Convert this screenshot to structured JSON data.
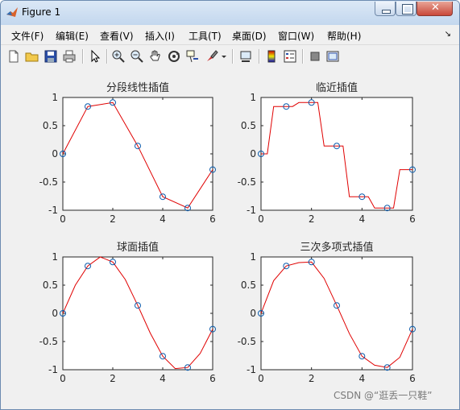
{
  "window": {
    "title": "Figure 1"
  },
  "menu": [
    "文件(F)",
    "编辑(E)",
    "查看(V)",
    "插入(I)",
    "工具(T)",
    "桌面(D)",
    "窗口(W)",
    "帮助(H)"
  ],
  "menu_overflow_icon": "chevron-icon",
  "toolbar_icons": [
    "new-figure-icon",
    "open-file-icon",
    "save-icon",
    "print-icon",
    "pointer-icon",
    "zoom-in-icon",
    "zoom-out-icon",
    "pan-hand-icon",
    "rotate-3d-icon",
    "data-cursor-icon",
    "brush-icon",
    "brush-dropdown-icon",
    "link-plot-icon",
    "colorbar-icon",
    "legend-icon",
    "hide-plot-tools-icon",
    "show-plot-tools-icon"
  ],
  "watermark": "CSDN @“逛丢一只鞋”",
  "chart_data": [
    {
      "type": "line",
      "title": "分段线性插值",
      "xlim": [
        0,
        6
      ],
      "ylim": [
        -1,
        1
      ],
      "xticks": [
        "0",
        "2",
        "4",
        "6"
      ],
      "yticks": [
        "1",
        "0.5",
        "0",
        "-0.5",
        "-1"
      ],
      "markers": {
        "x": [
          0,
          1,
          2,
          3,
          4,
          5,
          6
        ],
        "y": [
          0,
          0.84,
          0.91,
          0.14,
          -0.76,
          -0.96,
          -0.28
        ]
      },
      "curve": {
        "x": [
          0,
          1,
          2,
          3,
          4,
          5,
          6
        ],
        "y": [
          0,
          0.84,
          0.91,
          0.14,
          -0.76,
          -0.96,
          -0.28
        ]
      },
      "colors": {
        "marker": "#0b5cad",
        "line": "#e00000"
      }
    },
    {
      "type": "line",
      "title": "临近插值",
      "xlim": [
        0,
        6
      ],
      "ylim": [
        -1,
        1
      ],
      "xticks": [
        "0",
        "2",
        "4",
        "6"
      ],
      "yticks": [
        "1",
        "0.5",
        "0",
        "-0.5",
        "-1"
      ],
      "markers": {
        "x": [
          0,
          1,
          2,
          3,
          4,
          5,
          6
        ],
        "y": [
          0,
          0.84,
          0.91,
          0.14,
          -0.76,
          -0.96,
          -0.28
        ]
      },
      "curve": {
        "x": [
          0,
          0.25,
          0.5,
          0.75,
          1,
          1.25,
          1.5,
          1.75,
          2,
          2.25,
          2.5,
          2.75,
          3,
          3.25,
          3.5,
          3.75,
          4,
          4.25,
          4.5,
          4.75,
          5,
          5.25,
          5.5,
          5.75,
          6
        ],
        "y": [
          0,
          0,
          0.84,
          0.84,
          0.84,
          0.84,
          0.91,
          0.91,
          0.91,
          0.91,
          0.14,
          0.14,
          0.14,
          0.14,
          -0.76,
          -0.76,
          -0.76,
          -0.76,
          -0.96,
          -0.96,
          -0.96,
          -0.96,
          -0.28,
          -0.28,
          -0.28
        ]
      },
      "colors": {
        "marker": "#0b5cad",
        "line": "#e00000"
      }
    },
    {
      "type": "line",
      "title": "球面插值",
      "xlim": [
        0,
        6
      ],
      "ylim": [
        -1,
        1
      ],
      "xticks": [
        "0",
        "2",
        "4",
        "6"
      ],
      "yticks": [
        "1",
        "0.5",
        "0",
        "-0.5",
        "-1"
      ],
      "markers": {
        "x": [
          0,
          1,
          2,
          3,
          4,
          5,
          6
        ],
        "y": [
          0,
          0.84,
          0.91,
          0.14,
          -0.76,
          -0.96,
          -0.28
        ]
      },
      "curve": {
        "x": [
          0,
          0.5,
          1,
          1.5,
          2,
          2.5,
          3,
          3.5,
          4,
          4.5,
          5,
          5.5,
          6
        ],
        "y": [
          0,
          0.5,
          0.84,
          1.0,
          0.91,
          0.6,
          0.14,
          -0.35,
          -0.76,
          -0.98,
          -0.96,
          -0.71,
          -0.28
        ]
      },
      "colors": {
        "marker": "#0b5cad",
        "line": "#e00000"
      }
    },
    {
      "type": "line",
      "title": "三次多项式插值",
      "xlim": [
        0,
        6
      ],
      "ylim": [
        -1,
        1
      ],
      "xticks": [
        "0",
        "2",
        "4",
        "6"
      ],
      "yticks": [
        "1",
        "0.5",
        "0",
        "-0.5",
        "-1"
      ],
      "markers": {
        "x": [
          0,
          1,
          2,
          3,
          4,
          5,
          6
        ],
        "y": [
          0,
          0.84,
          0.91,
          0.14,
          -0.76,
          -0.96,
          -0.28
        ]
      },
      "curve": {
        "x": [
          0,
          0.5,
          1,
          1.5,
          2,
          2.5,
          3,
          3.5,
          4,
          4.5,
          5,
          5.5,
          6
        ],
        "y": [
          0,
          0.58,
          0.84,
          0.9,
          0.91,
          0.62,
          0.14,
          -0.36,
          -0.76,
          -0.92,
          -0.96,
          -0.78,
          -0.28
        ]
      },
      "colors": {
        "marker": "#0b5cad",
        "line": "#e00000"
      }
    }
  ]
}
